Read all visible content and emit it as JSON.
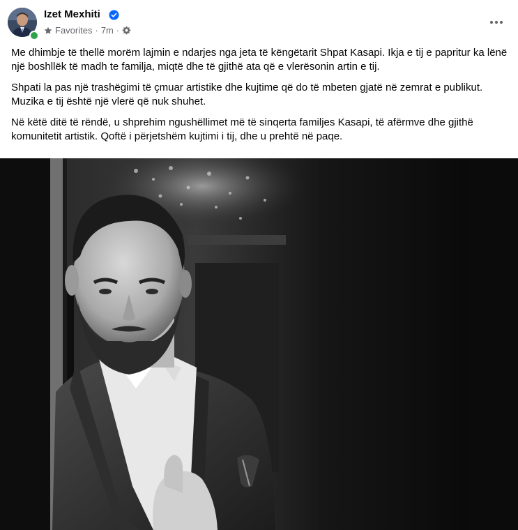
{
  "post": {
    "author": "Izet Mexhiti",
    "audience": "Favorites",
    "time": "7m",
    "paragraphs": [
      "Me dhimbje të thellë morëm lajmin e ndarjes nga jeta të këngëtarit Shpat Kasapi. Ikja e tij e papritur ka lënë një boshllëk të madh te familja, miqtë dhe të gjithë ata që e vlerësonin artin e tij.",
      "Shpati la pas një trashëgimi të çmuar artistike dhe kujtime që do të mbeten gjatë në zemrat e publikut. Muzika e tij është një vlerë që nuk shuhet.",
      "Në këtë ditë të rëndë, u shprehim ngushëllimet më të sinqerta familjes Kasapi, të afërmve dhe gjithë komunitetit artistik. Qoftë i përjetshëm kujtimi i tij, dhe u prehtë në paqe."
    ]
  },
  "icons": {
    "verified": "verified-badge-icon",
    "favorites": "star-icon",
    "settings": "gear-icon",
    "more": "more-options-icon"
  },
  "colors": {
    "verified_blue": "#0866ff",
    "online_green": "#31a24c",
    "meta_gray": "#65676b"
  }
}
